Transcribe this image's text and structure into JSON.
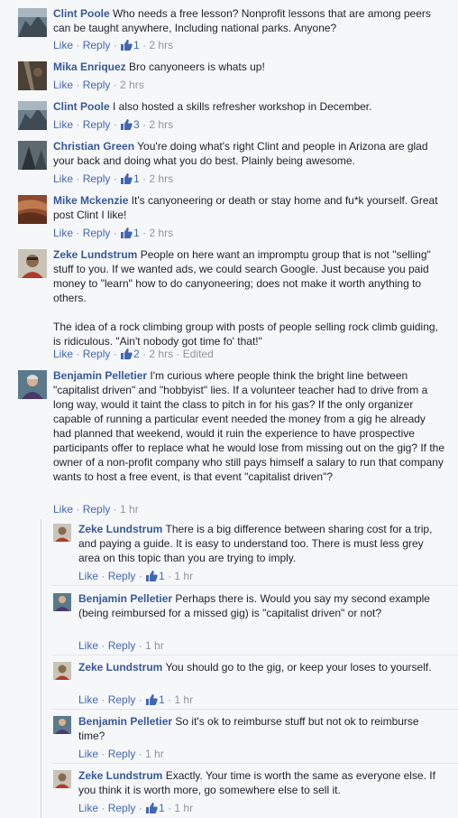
{
  "actions": {
    "like": "Like",
    "reply": "Reply",
    "edited": "Edited"
  },
  "comments": [
    {
      "author": "Clint Poole",
      "text": "Who needs a free lesson? Nonprofit lessons that are among peers can be taught anywhere, Including national parks. Anyone?",
      "likes": "1",
      "time": "2 hrs"
    },
    {
      "author": "Mika Enriquez",
      "text": "Bro canyoneers is whats up!",
      "time": "2 hrs"
    },
    {
      "author": "Clint Poole",
      "text": "I also hosted a skills refresher workshop in December.",
      "likes": "3",
      "time": "2 hrs"
    },
    {
      "author": "Christian Green",
      "text": "You're doing what's right Clint and people in Arizona are glad your back and doing what you do best. Plainly being awesome.",
      "likes": "1",
      "time": "2 hrs"
    },
    {
      "author": "Mike Mckenzie",
      "text": "It's canyoneering or death or stay home and fu*k yourself. Great post Clint I like!",
      "likes": "1",
      "time": "2 hrs"
    },
    {
      "author": "Zeke Lundstrum",
      "text": "People on here want an impromptu group that is not \"selling\" stuff to you. If we wanted ads, we could search Google. Just because you paid money to \"learn\" how to do canyoneering; does not make it worth anything to others.",
      "text2": "The idea of a rock climbing group with posts of people selling rock climb guiding, is ridiculous. \"Ain't nobody got time fo' that!\"",
      "likes": "2",
      "time": "2 hrs"
    },
    {
      "author": "Benjamin Pelletier",
      "text": "I'm curious where people think the bright line between \"capitalist driven\" and \"hobbyist\" lies. If a volunteer teacher had to drive from a long way, would it taint the class to pitch in for his gas? If the only organizer capable of running a particular event needed the money from a gig he already had planned that weekend, would it ruin the experience to have prospective participants offer to replace what he would lose from missing out on the gig? If the owner of a non-profit company who still pays himself a salary to run that company wants to host a free event, is that event \"capitalist driven\"?",
      "time": "1 hr"
    }
  ],
  "replies": [
    {
      "author": "Zeke Lundstrum",
      "text": "There is a big difference between sharing cost for a trip, and paying a guide. It is easy to understand too. There is must less grey area on this topic than you are trying to imply.",
      "likes": "1",
      "time": "1 hr"
    },
    {
      "author": "Benjamin Pelletier",
      "text": "Perhaps there is. Would you say my second example (being reimbursed for a missed gig) is \"capitalist driven\" or not?",
      "time": "1 hr"
    },
    {
      "author": "Zeke Lundstrum",
      "text": "You should go to the gig, or keep your loses to yourself.",
      "likes": "1",
      "time": "1 hr"
    },
    {
      "author": "Benjamin Pelletier",
      "text": "So it's ok to reimburse stuff but not ok to reimburse time?",
      "time": "1 hr"
    },
    {
      "author": "Zeke Lundstrum",
      "text": "Exactly. Your time is worth the same as everyone else. If you think it is worth more, go somewhere else to sell it.",
      "likes": "1",
      "time": "1 hr"
    }
  ],
  "colors": {
    "link": "#365899",
    "action": "#4267b2",
    "meta": "#90949c",
    "text": "#1d2129",
    "background": "#f6f7f9"
  },
  "icons": {
    "like_count": "thumbs-up-icon"
  }
}
